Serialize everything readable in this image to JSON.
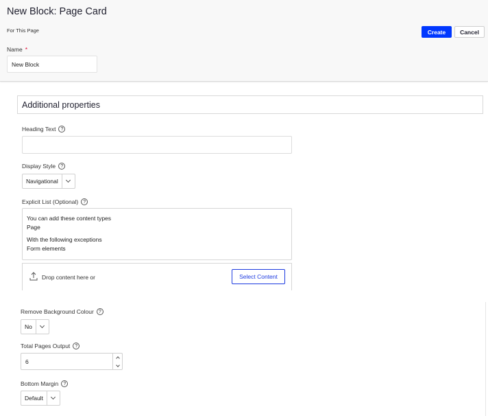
{
  "header": {
    "title": "New Block: Page Card",
    "subtitle": "For This Page",
    "create_label": "Create",
    "cancel_label": "Cancel",
    "name_label": "Name",
    "required_mark": "*",
    "name_value": "New Block"
  },
  "section": {
    "title": "Additional properties"
  },
  "fields": {
    "heading_text": {
      "label": "Heading Text",
      "value": ""
    },
    "display_style": {
      "label": "Display Style",
      "value": "Navigational"
    },
    "explicit_list": {
      "label": "Explicit List (Optional)",
      "types_heading": "You can add these content types",
      "types_value": "Page",
      "exceptions_heading": "With the following exceptions",
      "exceptions_value": "Form elements",
      "drop_text": "Drop content here or",
      "select_label": "Select Content"
    },
    "remove_background": {
      "label": "Remove Background Colour",
      "value": "No"
    },
    "total_pages": {
      "label": "Total Pages Output",
      "value": "6"
    },
    "bottom_margin": {
      "label": "Bottom Margin",
      "value": "Default"
    }
  },
  "icons": {
    "help": "?"
  },
  "colors": {
    "primary": "#0037ff",
    "required": "#e0002a"
  }
}
